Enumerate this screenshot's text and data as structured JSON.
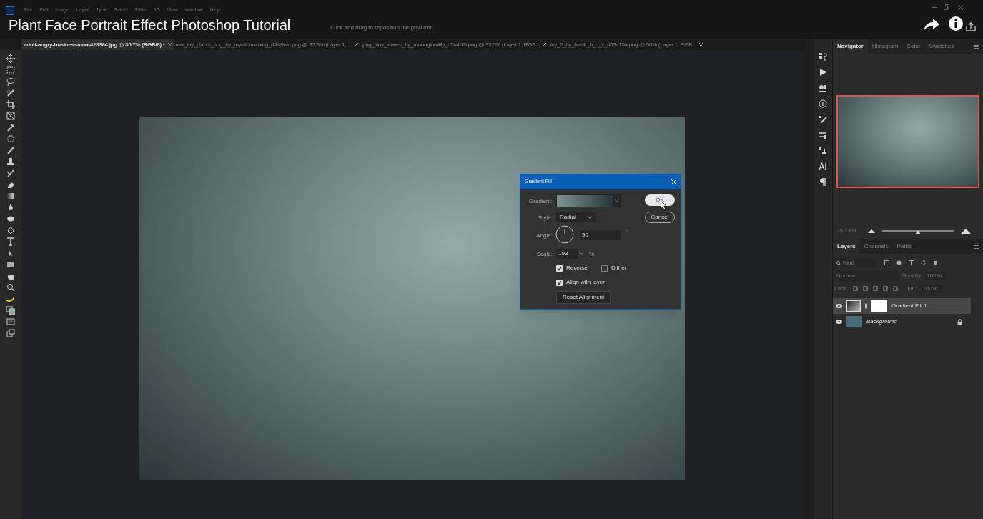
{
  "menu": [
    "File",
    "Edit",
    "Image",
    "Layer",
    "Type",
    "Select",
    "Filter",
    "3D",
    "View",
    "Window",
    "Help"
  ],
  "video_title": "Plant Face Portrait Effect Photoshop Tutorial",
  "hint": "Click and drag to reposition the gradient.",
  "tabs": [
    {
      "label": "adult-angry-businessman-428364.jpg @ 35,7% (RGB/8) *",
      "selected": true
    },
    {
      "label": "real_ivy_plants_png_by_mysticmorning_d4sj9wu.png @ 33,3% (Layer 1, ...",
      "selected": false
    },
    {
      "label": "png_viny_leaves_by_moonglowlilly_d5n4df5.png @ 33,3% (Layer 1, RGB...",
      "selected": false
    },
    {
      "label": "ivy_2_by_black_b_o_x_d53s75a.png @ 50% (Layer 1, RGB...",
      "selected": false
    }
  ],
  "dialog": {
    "title": "Gradient Fill",
    "gradient_label": "Gradient:",
    "style_label": "Style:",
    "style_value": "Radial",
    "angle_label": "Angle:",
    "angle_value": "90",
    "angle_unit": "°",
    "scale_label": "Scale:",
    "scale_value": "193",
    "scale_unit": "%",
    "checkboxes": [
      {
        "label": "Reverse",
        "checked": true
      },
      {
        "label": "Dither",
        "checked": false
      },
      {
        "label": "Align with layer",
        "checked": true
      }
    ],
    "reset_button": "Reset Alignment",
    "ok_button": "OK",
    "cancel_button": "Cancel"
  },
  "panel_tabs": [
    {
      "label": "Navigator",
      "selected": true
    },
    {
      "label": "Histogram",
      "selected": false
    },
    {
      "label": "Color",
      "selected": false
    },
    {
      "label": "Swatches",
      "selected": false
    }
  ],
  "navigator": {
    "zoom": "35,73%",
    "level": 0.5
  },
  "layers_tabs": [
    {
      "label": "Layers",
      "selected": true
    },
    {
      "label": "Channels",
      "selected": false
    },
    {
      "label": "Paths",
      "selected": false
    }
  ],
  "layers_panel": {
    "filter_placeholder": "Kind",
    "blend_mode": "Normal",
    "opacity_label": "Opacity:",
    "opacity": "100%",
    "lock_label": "Lock:",
    "fill_label": "Fill:",
    "fill": "100%"
  },
  "layers": [
    {
      "name": "Gradient Fill 1",
      "kind": "fill",
      "selected": true,
      "locked": false
    },
    {
      "name": "Background",
      "kind": "background",
      "selected": false,
      "locked": true
    }
  ]
}
